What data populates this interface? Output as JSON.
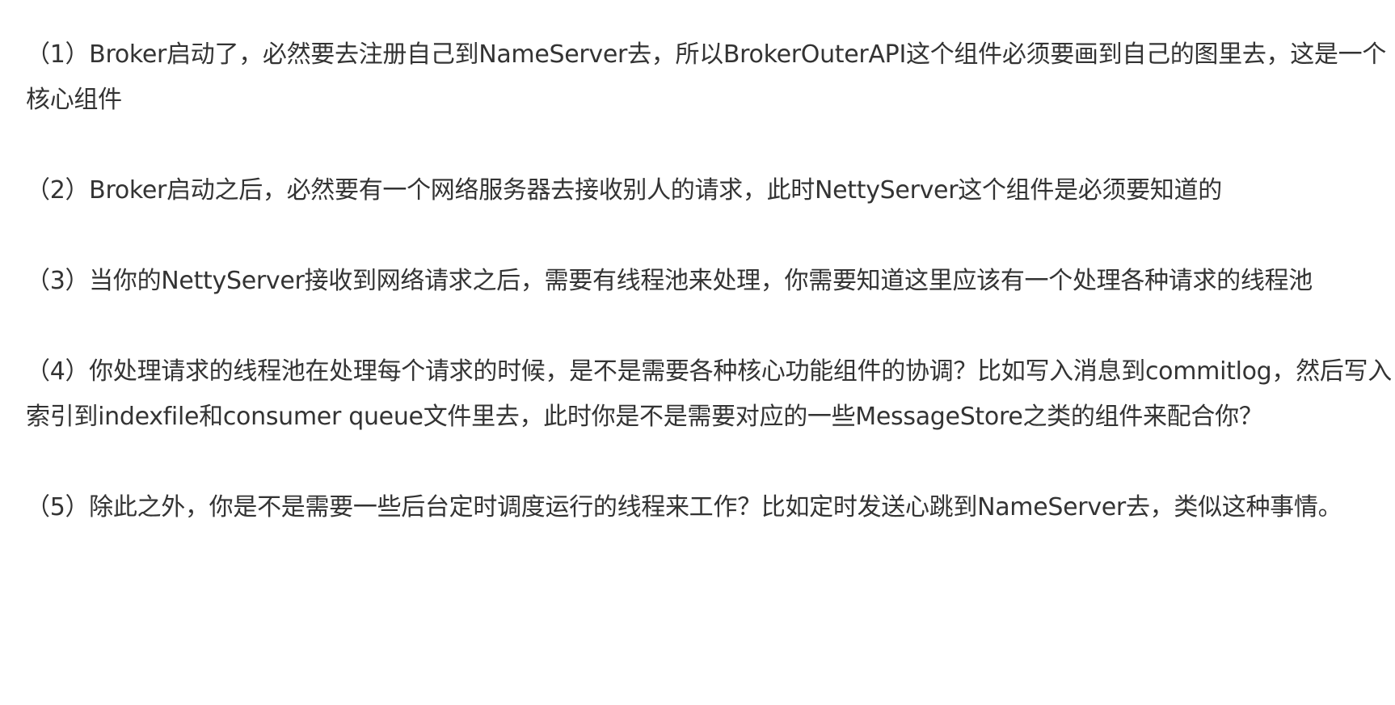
{
  "article": {
    "paragraphs": [
      {
        "text": "（1）Broker启动了，必然要去注册自己到NameServer去，所以BrokerOuterAPI这个组件必须要画到自己的图里去，这是一个核心组件"
      },
      {
        "text": "（2）Broker启动之后，必然要有一个网络服务器去接收别人的请求，此时NettyServer这个组件是必须要知道的"
      },
      {
        "text": "（3）当你的NettyServer接收到网络请求之后，需要有线程池来处理，你需要知道这里应该有一个处理各种请求的线程池"
      },
      {
        "text": "（4）你处理请求的线程池在处理每个请求的时候，是不是需要各种核心功能组件的协调？比如写入消息到commitlog，然后写入索引到indexfile和consumer queue文件里去，此时你是不是需要对应的一些MessageStore之类的组件来配合你？"
      },
      {
        "text": "（5）除此之外，你是不是需要一些后台定时调度运行的线程来工作？比如定时发送心跳到NameServer去，类似这种事情。"
      }
    ]
  }
}
